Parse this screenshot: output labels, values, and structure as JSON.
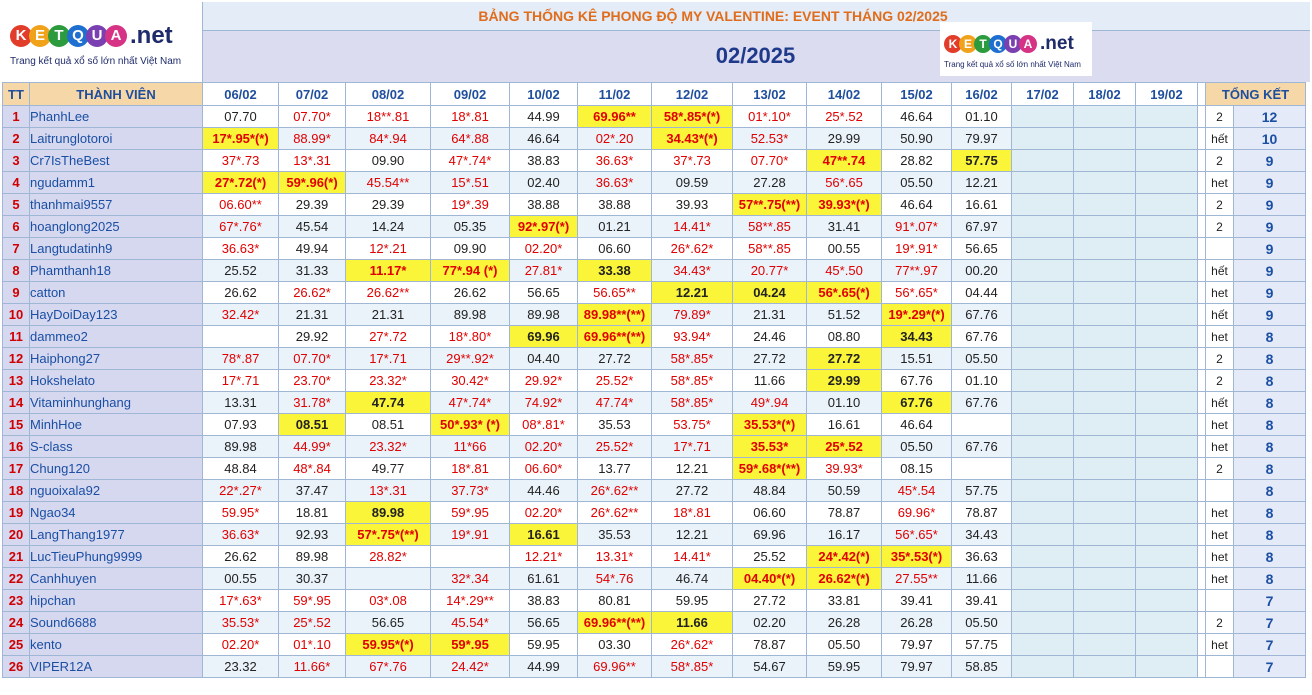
{
  "header": {
    "title": "BẢNG THỐNG KÊ PHONG ĐỘ MY VALENTINE: EVENT THÁNG 02/2025",
    "month": "02/2025",
    "logo_text": "KETQUA",
    "logo_suffix": ".net",
    "logo_tagline": "Trang kết quả xổ số lớn nhất Việt Nam"
  },
  "columns": {
    "tt": "TT",
    "member": "THÀNH VIÊN",
    "dates": [
      "06/02",
      "07/02",
      "08/02",
      "09/02",
      "10/02",
      "11/02",
      "12/02",
      "13/02",
      "14/02",
      "15/02",
      "16/02",
      "17/02",
      "18/02",
      "19/02"
    ],
    "summary": "TỔNG KẾT"
  },
  "rows": [
    {
      "tt": "1",
      "name": "PhanhLee",
      "vals": [
        "07.70",
        "07.70*",
        "18**.81",
        "18*.81",
        "44.99",
        "69.96**",
        "58*.85*(*)",
        "01*.10*",
        "25*.52",
        "46.64",
        "01.10"
      ],
      "note": "2",
      "pts": "12"
    },
    {
      "tt": "2",
      "name": "Laitrunglotoroi",
      "vals": [
        "17*.95*(*)",
        "88.99*",
        "84*.94",
        "64*.88",
        "46.64",
        "02*.20",
        "34.43*(*)",
        "52.53*",
        "29.99",
        "50.90",
        "79.97"
      ],
      "note": "hết",
      "pts": "10"
    },
    {
      "tt": "3",
      "name": "Cr7IsTheBest",
      "vals": [
        "37*.73",
        "13*.31",
        "09.90",
        "47*.74*",
        "38.83",
        "36.63*",
        "37*.73",
        "07.70*",
        "47**.74",
        "28.82",
        "57.75"
      ],
      "note": "2",
      "pts": "9"
    },
    {
      "tt": "4",
      "name": "ngudamm1",
      "vals": [
        "27*.72(*)",
        "59*.96(*)",
        "45.54**",
        "15*.51",
        "02.40",
        "36.63*",
        "09.59",
        "27.28",
        "56*.65",
        "05.50",
        "12.21"
      ],
      "note": "het",
      "pts": "9"
    },
    {
      "tt": "5",
      "name": "thanhmai9557",
      "vals": [
        "06.60**",
        "29.39",
        "29.39",
        "19*.39",
        "38.88",
        "38.88",
        "39.93",
        "57**.75(**)",
        "39.93*(*)",
        "46.64",
        "16.61"
      ],
      "note": "2",
      "pts": "9"
    },
    {
      "tt": "6",
      "name": "hoanglong2025",
      "vals": [
        "67*.76*",
        "45.54",
        "14.24",
        "05.35",
        "92*.97(*)",
        "01.21",
        "14.41*",
        "58**.85",
        "31.41",
        "91*.07*",
        "67.97"
      ],
      "note": "2",
      "pts": "9"
    },
    {
      "tt": "7",
      "name": "Langtudatinh9",
      "vals": [
        "36.63*",
        "49.94",
        "12*.21",
        "09.90",
        "02.20*",
        "06.60",
        "26*.62*",
        "58**.85",
        "00.55",
        "19*.91*",
        "56.65"
      ],
      "note": "",
      "pts": "9"
    },
    {
      "tt": "8",
      "name": "Phamthanh18",
      "vals": [
        "25.52",
        "31.33",
        "11.17*",
        "77*.94 (*)",
        "27.81*",
        "33.38",
        "34.43*",
        "20.77*",
        "45*.50",
        "77**.97",
        "00.20"
      ],
      "note": "hết",
      "pts": "9"
    },
    {
      "tt": "9",
      "name": "catton",
      "vals": [
        "26.62",
        "26.62*",
        "26.62**",
        "26.62",
        "56.65",
        "56.65**",
        "12.21",
        "04.24",
        "56*.65(*)",
        "56*.65*",
        "04.44"
      ],
      "note": "het",
      "pts": "9"
    },
    {
      "tt": "10",
      "name": "HayDoiDay123",
      "vals": [
        "32.42*",
        "21.31",
        "21.31",
        "89.98",
        "89.98",
        "89.98**(**)",
        "79.89*",
        "21.31",
        "51.52",
        "19*.29*(*)",
        "67.76"
      ],
      "note": "hết",
      "pts": "9"
    },
    {
      "tt": "11",
      "name": "dammeo2",
      "vals": [
        "",
        "29.92",
        "27*.72",
        "18*.80*",
        "69.96",
        "69.96**(**)",
        "93.94*",
        "24.46",
        "08.80",
        "34.43",
        "67.76"
      ],
      "note": "het",
      "pts": "8"
    },
    {
      "tt": "12",
      "name": "Haiphong27",
      "vals": [
        "78*.87",
        "07.70*",
        "17*.71",
        "29**.92*",
        "04.40",
        "27.72",
        "58*.85*",
        "27.72",
        "27.72",
        "15.51",
        "05.50"
      ],
      "note": "2",
      "pts": "8"
    },
    {
      "tt": "13",
      "name": "Hokshelato",
      "vals": [
        "17*.71",
        "23.70*",
        "23.32*",
        "30.42*",
        "29.92*",
        "25.52*",
        "58*.85*",
        "11.66",
        "29.99",
        "67.76",
        "01.10"
      ],
      "note": "2",
      "pts": "8"
    },
    {
      "tt": "14",
      "name": "Vitaminhunghang",
      "vals": [
        "13.31",
        "31.78*",
        "47.74",
        "47*.74*",
        "74.92*",
        "47.74*",
        "58*.85*",
        "49*.94",
        "01.10",
        "67.76",
        "67.76"
      ],
      "note": "hết",
      "pts": "8"
    },
    {
      "tt": "15",
      "name": "MinhHoe",
      "vals": [
        "07.93",
        "08.51",
        "08.51",
        "50*.93* (*)",
        "08*.81*",
        "35.53",
        "53.75*",
        "35.53*(*)",
        "16.61",
        "46.64",
        ""
      ],
      "note": "het",
      "pts": "8"
    },
    {
      "tt": "16",
      "name": "S-class",
      "vals": [
        "89.98",
        "44.99*",
        "23.32*",
        "11*66",
        "02.20*",
        "25.52*",
        "17*.71",
        "35.53*",
        "25*.52",
        "05.50",
        "67.76"
      ],
      "note": "het",
      "pts": "8"
    },
    {
      "tt": "17",
      "name": "Chung120",
      "vals": [
        "48.84",
        "48*.84",
        "49.77",
        "18*.81",
        "06.60*",
        "13.77",
        "12.21",
        "59*.68*(**)",
        "39.93*",
        "08.15",
        ""
      ],
      "note": "2",
      "pts": "8"
    },
    {
      "tt": "18",
      "name": "nguoixala92",
      "vals": [
        "22*.27*",
        "37.47",
        "13*.31",
        "37.73*",
        "44.46",
        "26*.62**",
        "27.72",
        "48.84",
        "50.59",
        "45*.54",
        "57.75"
      ],
      "note": "",
      "pts": "8"
    },
    {
      "tt": "19",
      "name": "Ngao34",
      "vals": [
        "59.95*",
        "18.81",
        "89.98",
        "59*.95",
        "02.20*",
        "26*.62**",
        "18*.81",
        "06.60",
        "78.87",
        "69.96*",
        "78.87"
      ],
      "note": "het",
      "pts": "8"
    },
    {
      "tt": "20",
      "name": "LangThang1977",
      "vals": [
        "36.63*",
        "92.93",
        "57*.75*(**)",
        "19*.91",
        "16.61",
        "35.53",
        "12.21",
        "69.96",
        "16.17",
        "56*.65*",
        "34.43"
      ],
      "note": "het",
      "pts": "8"
    },
    {
      "tt": "21",
      "name": "LucTieuPhung9999",
      "vals": [
        "26.62",
        "89.98",
        "28.82*",
        "",
        "12.21*",
        "13.31*",
        "14.41*",
        "25.52",
        "24*.42(*)",
        "35*.53(*)",
        "36.63"
      ],
      "note": "het",
      "pts": "8"
    },
    {
      "tt": "22",
      "name": "Canhhuyen",
      "vals": [
        "00.55",
        "30.37",
        "",
        "32*.34",
        "61.61",
        "54*.76",
        "46.74",
        "04.40*(*)",
        "26.62*(*)",
        "27.55**",
        "11.66"
      ],
      "note": "het",
      "pts": "8"
    },
    {
      "tt": "23",
      "name": "hipchan",
      "vals": [
        "17*.63*",
        "59*.95",
        "03*.08",
        "14*.29**",
        "38.83",
        "80.81",
        "59.95",
        "27.72",
        "33.81",
        "39.41",
        "39.41"
      ],
      "note": "",
      "pts": "7"
    },
    {
      "tt": "24",
      "name": "Sound6688",
      "vals": [
        "35.53*",
        "25*.52",
        "56.65",
        "45.54*",
        "56.65",
        "69.96**(**)",
        "11.66",
        "02.20",
        "26.28",
        "26.28",
        "05.50"
      ],
      "note": "2",
      "pts": "7"
    },
    {
      "tt": "25",
      "name": "kento",
      "vals": [
        "02.20*",
        "01*.10",
        "59.95*(*)",
        "59*.95",
        "59.95",
        "03.30",
        "26*.62*",
        "78.87",
        "05.50",
        "79.97",
        "57.75"
      ],
      "note": "het",
      "pts": "7"
    },
    {
      "tt": "26",
      "name": "VIPER12A",
      "vals": [
        "23.32",
        "11.66*",
        "67*.76",
        "24.42*",
        "44.99",
        "69.96**",
        "58*.85*",
        "54.67",
        "59.95",
        "79.97",
        "58.85"
      ],
      "note": "",
      "pts": "7"
    }
  ],
  "highlights": [
    [
      0,
      5
    ],
    [
      0,
      6
    ],
    [
      1,
      0
    ],
    [
      1,
      6
    ],
    [
      2,
      8
    ],
    [
      2,
      10
    ],
    [
      3,
      0
    ],
    [
      3,
      1
    ],
    [
      4,
      7
    ],
    [
      4,
      8
    ],
    [
      5,
      4
    ],
    [
      7,
      2
    ],
    [
      7,
      3
    ],
    [
      7,
      5
    ],
    [
      8,
      6
    ],
    [
      8,
      7
    ],
    [
      8,
      8
    ],
    [
      9,
      5
    ],
    [
      9,
      9
    ],
    [
      10,
      4
    ],
    [
      10,
      5
    ],
    [
      10,
      9
    ],
    [
      11,
      8
    ],
    [
      12,
      8
    ],
    [
      13,
      2
    ],
    [
      13,
      9
    ],
    [
      14,
      1
    ],
    [
      14,
      3
    ],
    [
      14,
      7
    ],
    [
      15,
      7
    ],
    [
      15,
      8
    ],
    [
      16,
      7
    ],
    [
      18,
      2
    ],
    [
      19,
      2
    ],
    [
      19,
      4
    ],
    [
      20,
      8
    ],
    [
      20,
      9
    ],
    [
      21,
      7
    ],
    [
      21,
      8
    ],
    [
      23,
      5
    ],
    [
      23,
      6
    ],
    [
      24,
      2
    ],
    [
      24,
      3
    ]
  ],
  "colors": {
    "accent": "#e06d1b",
    "member": "#1a4fa3",
    "hit": "#e00000",
    "highlight": "#fbf53a"
  }
}
